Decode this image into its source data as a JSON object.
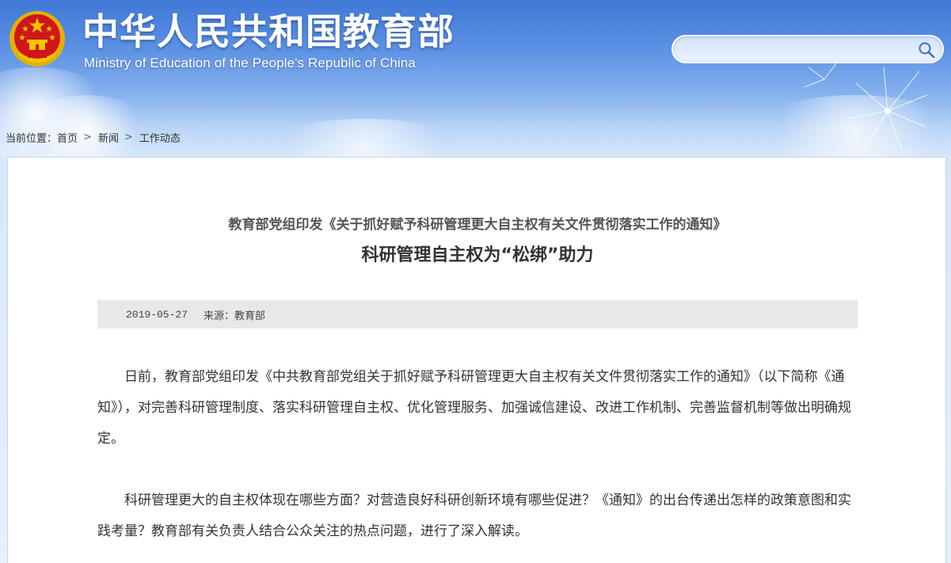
{
  "header": {
    "site_title": "中华人民共和国教育部",
    "site_subtitle": "Ministry of Education of the People's Republic of China",
    "emblem_icon": "national-emblem-icon"
  },
  "search": {
    "value": "",
    "placeholder": "",
    "icon": "search-icon"
  },
  "breadcrumb": {
    "label": "当前位置：",
    "items": [
      "首页",
      "新闻",
      "工作动态"
    ],
    "separator": ">"
  },
  "article": {
    "kicker": "教育部党组印发《关于抓好赋予科研管理更大自主权有关文件贯彻落实工作的通知》",
    "title": "科研管理自主权为“松绑”助力",
    "date": "2019-05-27",
    "source_label": "来源：",
    "source": "教育部",
    "paragraphs": [
      "日前，教育部党组印发《中共教育部党组关于抓好赋予科研管理更大自主权有关文件贯彻落实工作的通知》（以下简称《通知》），对完善科研管理制度、落实科研管理自主权、优化管理服务、加强诚信建设、改进工作机制、完善监督机制等做出明确规定。",
      "科研管理更大的自主权体现在哪些方面？对营造良好科研创新环境有哪些促进？《通知》的出台传递出怎样的政策意图和实践考量？教育部有关负责人结合公众关注的热点问题，进行了深入解读。"
    ]
  },
  "colors": {
    "header_blue": "#3f78d6",
    "panel_bg": "#ffffff",
    "meta_bar_bg": "#e8e8e8",
    "text": "#333333",
    "emblem_red": "#d0161b",
    "emblem_gold": "#f5c400"
  }
}
